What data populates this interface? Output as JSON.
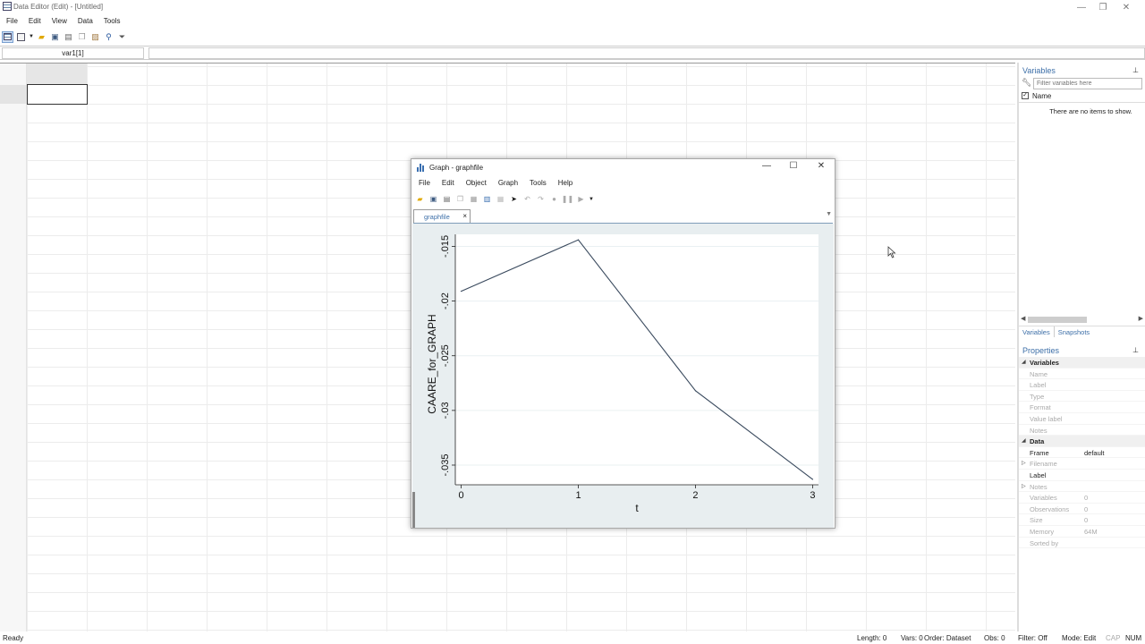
{
  "app": {
    "title": "Data Editor (Edit) - [Untitled]",
    "window_controls": {
      "minimize": "—",
      "restore": "❐",
      "close": "✕"
    }
  },
  "menu": [
    "File",
    "Edit",
    "View",
    "Data",
    "Tools"
  ],
  "toolbar": {
    "icons": [
      "data-editor-icon",
      "variables-manager-icon",
      "open-icon",
      "save-icon",
      "print-icon",
      "copy-icon",
      "paste-icon",
      "find-icon",
      "filter-icon"
    ]
  },
  "address": {
    "cell_ref": "var1[1]",
    "value": ""
  },
  "variables_panel": {
    "title": "Variables",
    "filter_placeholder": "Filter variables here",
    "column_name": "Name",
    "empty_message": "There are no items to show.",
    "tabs": [
      "Variables",
      "Snapshots"
    ]
  },
  "properties_panel": {
    "title": "Properties",
    "rows": [
      {
        "key": "Variables",
        "value": "",
        "section": true
      },
      {
        "key": "Name",
        "value": ""
      },
      {
        "key": "Label",
        "value": ""
      },
      {
        "key": "Type",
        "value": ""
      },
      {
        "key": "Format",
        "value": ""
      },
      {
        "key": "Value label",
        "value": ""
      },
      {
        "key": "Notes",
        "value": ""
      },
      {
        "key": "Data",
        "value": "",
        "section": true
      },
      {
        "key": "Frame",
        "value": "default",
        "strong": true
      },
      {
        "key": "Filename",
        "value": "",
        "expand": true
      },
      {
        "key": "Label",
        "value": "",
        "strong": true
      },
      {
        "key": "Notes",
        "value": "",
        "expand": true
      },
      {
        "key": "Variables",
        "value": "0"
      },
      {
        "key": "Observations",
        "value": "0"
      },
      {
        "key": "Size",
        "value": "0"
      },
      {
        "key": "Memory",
        "value": "64M"
      },
      {
        "key": "Sorted by",
        "value": ""
      }
    ]
  },
  "status": {
    "ready": "Ready",
    "length": "Length: 0",
    "vars": "Vars: 0",
    "order": "Order: Dataset",
    "obs": "Obs: 0",
    "filter": "Filter: Off",
    "mode": "Mode: Edit",
    "cap": "CAP",
    "num": "NUM"
  },
  "graph_window": {
    "title": "Graph - graphfile",
    "menu": [
      "File",
      "Edit",
      "Object",
      "Graph",
      "Tools",
      "Help"
    ],
    "tab": "graphfile",
    "tab_close": "×"
  },
  "chart_data": {
    "type": "line",
    "x": [
      0,
      1,
      2,
      3
    ],
    "series": [
      {
        "values": [
          -0.0191,
          -0.0144,
          -0.0282,
          -0.0363
        ]
      }
    ],
    "xlabel": "t",
    "ylabel": "CAARE_for_GRAPH",
    "xticks": [
      {
        "value": 0,
        "label": "0"
      },
      {
        "value": 1,
        "label": "1"
      },
      {
        "value": 2,
        "label": "2"
      },
      {
        "value": 3,
        "label": "3"
      }
    ],
    "yticks": [
      {
        "value": -0.015,
        "label": "-.015"
      },
      {
        "value": -0.02,
        "label": "-.02"
      },
      {
        "value": -0.025,
        "label": "-.025"
      },
      {
        "value": -0.03,
        "label": "-.03"
      },
      {
        "value": -0.035,
        "label": "-.035"
      }
    ],
    "xlim": [
      -0.05,
      3.05
    ],
    "ylim": [
      -0.0368,
      -0.0139
    ],
    "colors": {
      "line": "#3a4a5e",
      "plot_bg": "#ffffff",
      "outer_bg": "#e8eef0",
      "grid": "#eaf0f2"
    },
    "grid": true
  }
}
